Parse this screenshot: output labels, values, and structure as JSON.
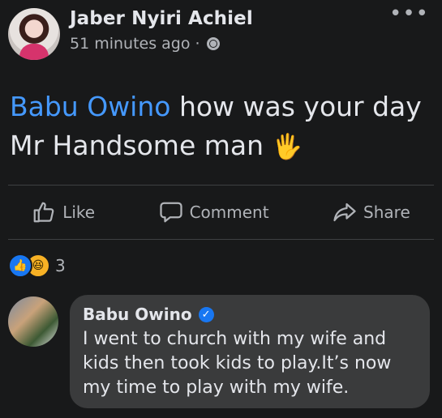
{
  "post": {
    "author": "Jaber Nyiri Achiel",
    "time": "51 minutes ago",
    "separator": "·",
    "privacy_icon": "globe-icon",
    "more_icon": "more-icon",
    "mention": "Babu Owino",
    "text_rest": " how was your day Mr Handsome man ",
    "emoji": "🖐"
  },
  "actions": {
    "like": "Like",
    "comment": "Comment",
    "share": "Share"
  },
  "reactions": {
    "count": "3",
    "icons": [
      "like-reaction-icon",
      "haha-reaction-icon"
    ]
  },
  "comment": {
    "author": "Babu Owino",
    "verified": true,
    "text": "I went to church with my wife and kids then took kids to play.It’s now my time to play with my wife."
  },
  "colors": {
    "background": "#18191a",
    "mention": "#4599ff",
    "bubble": "#3a3b3c",
    "verified": "#1877f2"
  }
}
